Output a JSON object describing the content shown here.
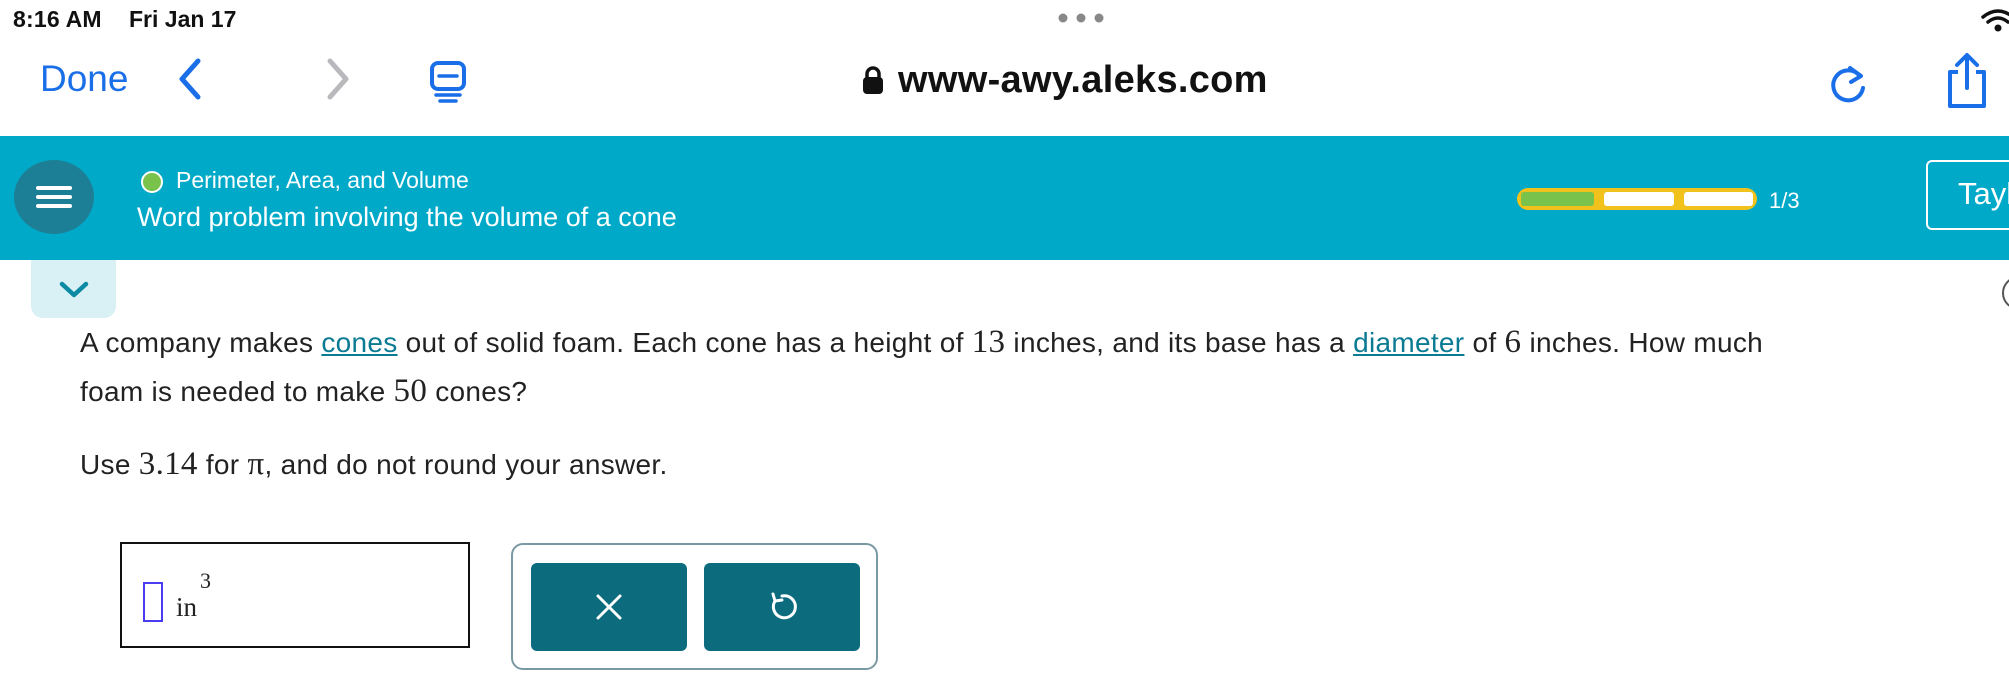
{
  "status_bar": {
    "time": "8:16 AM",
    "date": "Fri Jan 17"
  },
  "browser": {
    "done_label": "Done",
    "url": "www-awy.aleks.com",
    "icons": [
      "back-chevron-icon",
      "forward-chevron-icon",
      "reader-icon",
      "lock-icon",
      "reload-icon",
      "share-icon",
      "wifi-icon",
      "more-dots-icon"
    ]
  },
  "header": {
    "topic": "Perimeter, Area, and Volume",
    "subtopic": "Word problem involving the volume of a cone",
    "progress": {
      "label": "1/3",
      "completed": 1,
      "total": 3
    },
    "user_button_label": "Tayl"
  },
  "question": {
    "part1": "A company makes ",
    "link1": "cones",
    "part2": " out of solid foam. Each cone has a height of ",
    "height": "13",
    "part3": " inches, and its base has a ",
    "link2": "diameter",
    "part4": " of ",
    "diameter": "6",
    "part5": " inches. How much",
    "line2_a": "foam is needed to make ",
    "count": "50",
    "line2_b": " cones?",
    "instr_a": "Use ",
    "pi_value": "3.14",
    "instr_b": " for ",
    "pi_symbol": "π",
    "instr_c": ", and do not round your answer."
  },
  "answer": {
    "value": "",
    "unit": "in",
    "unit_exponent": "3"
  },
  "colors": {
    "header_bg": "#01a9c9",
    "link": "#0b7b94",
    "tool_button": "#0c6b7d",
    "safari_blue": "#1a6fe8",
    "progress_track": "#f1c21b",
    "progress_done": "#79c24c"
  }
}
